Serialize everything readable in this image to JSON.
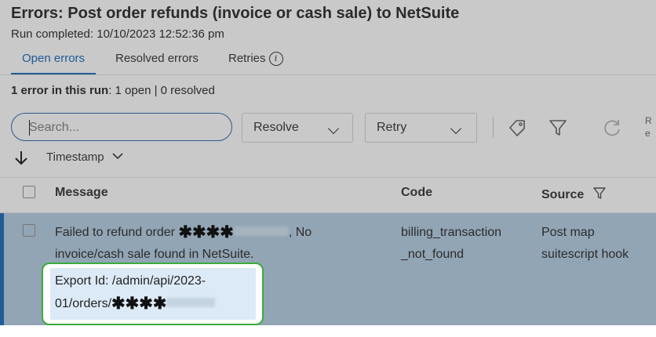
{
  "header": {
    "title": "Errors: Post order refunds (invoice or cash sale) to NetSuite",
    "subtitle": "Run completed: 10/10/2023 12:52:36 pm"
  },
  "tabs": [
    {
      "label": "Open errors",
      "active": true
    },
    {
      "label": "Resolved errors",
      "active": false
    },
    {
      "label": "Retries",
      "active": false,
      "info_icon": "info-icon"
    }
  ],
  "summary": {
    "bold": "1 error in this run",
    "rest": ": 1 open | 0 resolved"
  },
  "toolbar": {
    "search_placeholder": "Search...",
    "resolve_label": "Resolve",
    "retry_label": "Retry",
    "icons": [
      "tag-icon",
      "filter-icon",
      "refresh-icon"
    ],
    "cut_text": "R e"
  },
  "sort": {
    "label": "Timestamp"
  },
  "table": {
    "columns": [
      "Message",
      "Code",
      "Source"
    ],
    "rows": [
      {
        "message_prefix": "Failed to refund order",
        "masked": "✱✱✱✱",
        "message_suffix": ", No",
        "message_line2": "invoice/cash sale found in NetSuite.",
        "code_line1": "billing_transaction",
        "code_line2": "_not_found",
        "source_line1": "Post map",
        "source_line2": "suitescript hook",
        "export_line1": "Export Id: /admin/api/2023-",
        "export_line2": "01/orders/"
      }
    ]
  },
  "colors": {
    "accent": "#1f5c96",
    "highlight_border": "#3caa3c",
    "selected_row": "#92a5b5"
  }
}
